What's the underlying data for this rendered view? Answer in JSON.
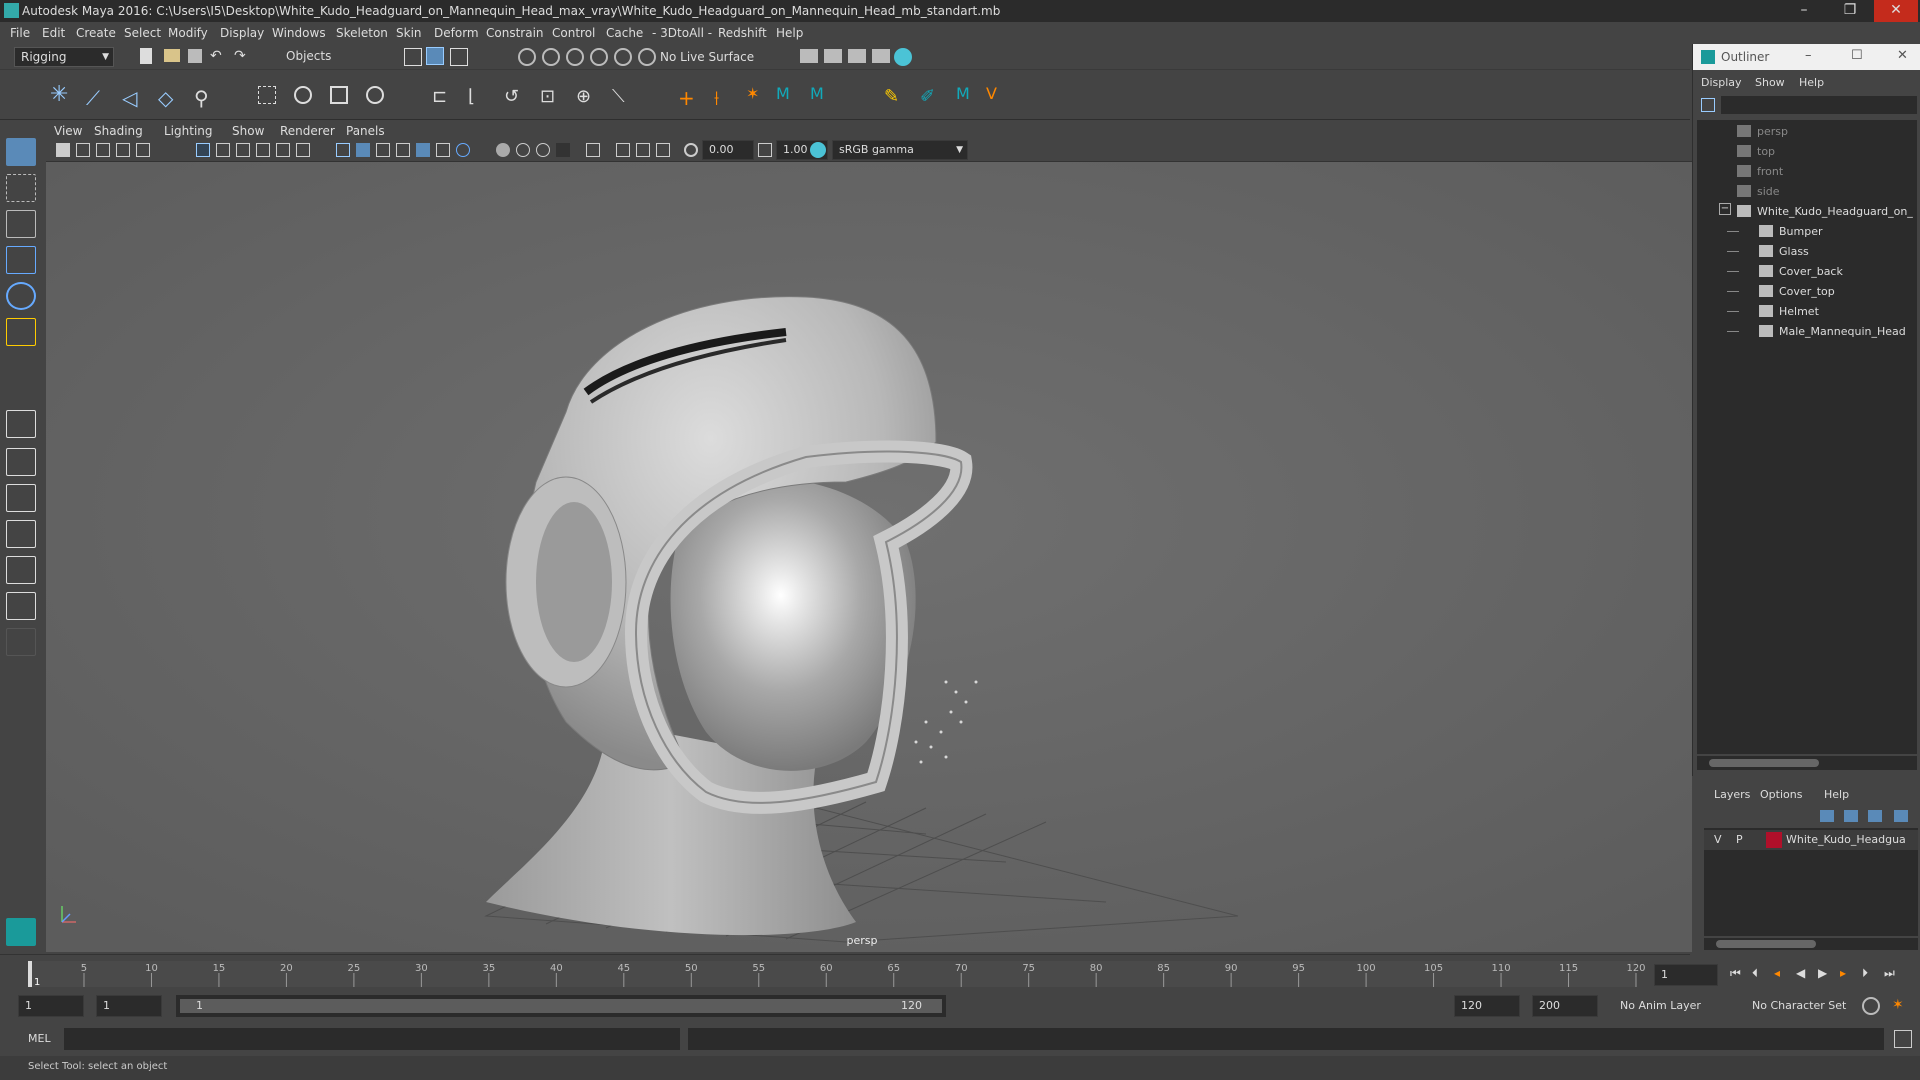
{
  "window": {
    "title": "Autodesk Maya 2016: C:\\Users\\I5\\Desktop\\White_Kudo_Headguard_on_Mannequin_Head_max_vray\\White_Kudo_Headguard_on_Mannequin_Head_mb_standart.mb",
    "minimize": "–",
    "restore": "❐",
    "close": "✕"
  },
  "menu": [
    "File",
    "Edit",
    "Create",
    "Select",
    "Modify",
    "Display",
    "Windows",
    "Skeleton",
    "Skin",
    "Deform",
    "Constrain",
    "Control",
    "Cache",
    "- 3DtoAll -",
    "Redshift",
    "Help"
  ],
  "status": {
    "mode": "Rigging",
    "select_mode": "Objects",
    "live_surface": "No Live Surface"
  },
  "panel_menu": [
    "View",
    "Shading",
    "Lighting",
    "Show",
    "Renderer",
    "Panels"
  ],
  "panel_tools": {
    "exposure": "0.00",
    "gamma": "1.00",
    "color_space": "sRGB gamma"
  },
  "viewport": {
    "camera_label": "persp"
  },
  "outliner": {
    "title": "Outliner",
    "menu": [
      "Display",
      "Show",
      "Help"
    ],
    "items": [
      {
        "label": "persp",
        "dim": true,
        "indent": 0
      },
      {
        "label": "top",
        "dim": true,
        "indent": 0
      },
      {
        "label": "front",
        "dim": true,
        "indent": 0
      },
      {
        "label": "side",
        "dim": true,
        "indent": 0
      },
      {
        "label": "White_Kudo_Headguard_on_",
        "dim": false,
        "indent": 0,
        "expander": "−"
      },
      {
        "label": "Bumper",
        "dim": false,
        "indent": 1
      },
      {
        "label": "Glass",
        "dim": false,
        "indent": 1
      },
      {
        "label": "Cover_back",
        "dim": false,
        "indent": 1
      },
      {
        "label": "Cover_top",
        "dim": false,
        "indent": 1
      },
      {
        "label": "Helmet",
        "dim": false,
        "indent": 1
      },
      {
        "label": "Male_Mannequin_Head",
        "dim": false,
        "indent": 1
      }
    ]
  },
  "layers": {
    "menu": [
      "Layers",
      "Options",
      "Help"
    ],
    "row": {
      "v": "V",
      "p": "P",
      "name": "White_Kudo_Headgua",
      "color": "#b0102a"
    }
  },
  "timeline": {
    "ticks": [
      "5",
      "10",
      "15",
      "20",
      "25",
      "30",
      "35",
      "40",
      "45",
      "50",
      "55",
      "60",
      "65",
      "70",
      "75",
      "80",
      "85",
      "90",
      "95",
      "100",
      "105",
      "110",
      "115",
      "120"
    ],
    "start_label": "1",
    "end_label": "120",
    "current_frame": "1"
  },
  "range": {
    "start": "1",
    "anim_start": "1",
    "slider_start": "1",
    "slider_end": "120",
    "anim_end": "120",
    "end": "200",
    "anim_layer": "No Anim Layer",
    "char_set": "No Character Set"
  },
  "mel": {
    "label": "MEL"
  },
  "help": {
    "text": "Select Tool: select an object"
  }
}
